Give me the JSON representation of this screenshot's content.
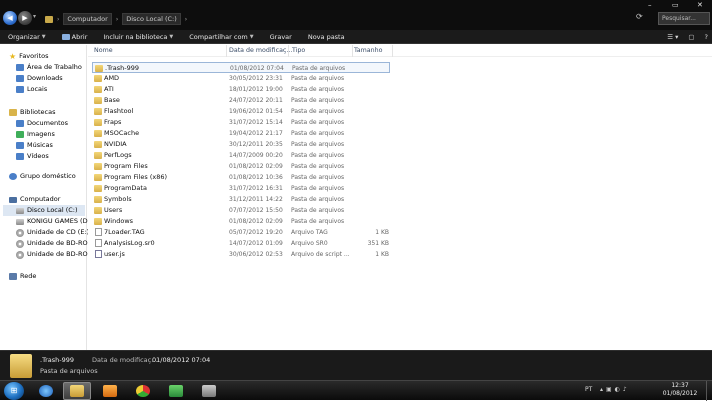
{
  "address": {
    "crumbs": [
      "Computador",
      "Disco Local (C:)"
    ],
    "search_placeholder": "Pesquisar..."
  },
  "toolbar": {
    "organize": "Organizar",
    "open": "Abrir",
    "include_library": "Incluir na biblioteca",
    "share": "Compartilhar com",
    "burn": "Gravar",
    "new_folder": "Nova pasta"
  },
  "nav": {
    "favorites_header": "Favoritos",
    "favorites": [
      "Área de Trabalho",
      "Downloads",
      "Locais"
    ],
    "libraries_header": "Bibliotecas",
    "libraries": [
      "Documentos",
      "Imagens",
      "Músicas",
      "Vídeos"
    ],
    "homegroup": "Grupo doméstico",
    "computer_header": "Computador",
    "drives": [
      "Disco Local (C:)",
      "KONIGU GAMES (D:)",
      "Unidade de CD (E:)",
      "Unidade de BD-ROM",
      "Unidade de BD-ROM"
    ],
    "network": "Rede"
  },
  "columns": {
    "name": "Nome",
    "date": "Data de modificaç...",
    "type": "Tipo",
    "size": "Tamanho"
  },
  "files": [
    {
      "name": ".Trash-999",
      "date": "01/08/2012 07:04",
      "type": "Pasta de arquivos",
      "size": "",
      "icon": "folder"
    },
    {
      "name": "AMD",
      "date": "30/05/2012 23:31",
      "type": "Pasta de arquivos",
      "size": "",
      "icon": "folder"
    },
    {
      "name": "ATI",
      "date": "18/01/2012 19:00",
      "type": "Pasta de arquivos",
      "size": "",
      "icon": "folder"
    },
    {
      "name": "Base",
      "date": "24/07/2012 20:11",
      "type": "Pasta de arquivos",
      "size": "",
      "icon": "folder"
    },
    {
      "name": "Flashtool",
      "date": "19/06/2012 01:54",
      "type": "Pasta de arquivos",
      "size": "",
      "icon": "folder"
    },
    {
      "name": "Fraps",
      "date": "31/07/2012 15:14",
      "type": "Pasta de arquivos",
      "size": "",
      "icon": "folder"
    },
    {
      "name": "MSOCache",
      "date": "19/04/2012 21:17",
      "type": "Pasta de arquivos",
      "size": "",
      "icon": "folder"
    },
    {
      "name": "NVIDIA",
      "date": "30/12/2011 20:35",
      "type": "Pasta de arquivos",
      "size": "",
      "icon": "folder"
    },
    {
      "name": "PerfLogs",
      "date": "14/07/2009 00:20",
      "type": "Pasta de arquivos",
      "size": "",
      "icon": "folder"
    },
    {
      "name": "Program Files",
      "date": "01/08/2012 02:09",
      "type": "Pasta de arquivos",
      "size": "",
      "icon": "folder"
    },
    {
      "name": "Program Files (x86)",
      "date": "01/08/2012 10:36",
      "type": "Pasta de arquivos",
      "size": "",
      "icon": "folder"
    },
    {
      "name": "ProgramData",
      "date": "31/07/2012 16:31",
      "type": "Pasta de arquivos",
      "size": "",
      "icon": "folder"
    },
    {
      "name": "Symbols",
      "date": "31/12/2011 14:22",
      "type": "Pasta de arquivos",
      "size": "",
      "icon": "folder"
    },
    {
      "name": "Users",
      "date": "07/07/2012 15:50",
      "type": "Pasta de arquivos",
      "size": "",
      "icon": "folder"
    },
    {
      "name": "Windows",
      "date": "01/08/2012 02:09",
      "type": "Pasta de arquivos",
      "size": "",
      "icon": "folder"
    },
    {
      "name": "7Loader.TAG",
      "date": "05/07/2012 19:20",
      "type": "Arquivo TAG",
      "size": "1 KB",
      "icon": "doc"
    },
    {
      "name": "AnalysisLog.sr0",
      "date": "14/07/2012 01:09",
      "type": "Arquivo SR0",
      "size": "351 KB",
      "icon": "doc"
    },
    {
      "name": "user.js",
      "date": "30/06/2012 02:53",
      "type": "Arquivo de script ...",
      "size": "1 KB",
      "icon": "js"
    }
  ],
  "details": {
    "name": ".Trash-999",
    "type": "Pasta de arquivos",
    "date_label": "Data de modificaç...",
    "date_value": "01/08/2012 07:04"
  },
  "taskbar": {
    "lang": "PT",
    "time": "12:37",
    "date": "01/08/2012"
  }
}
